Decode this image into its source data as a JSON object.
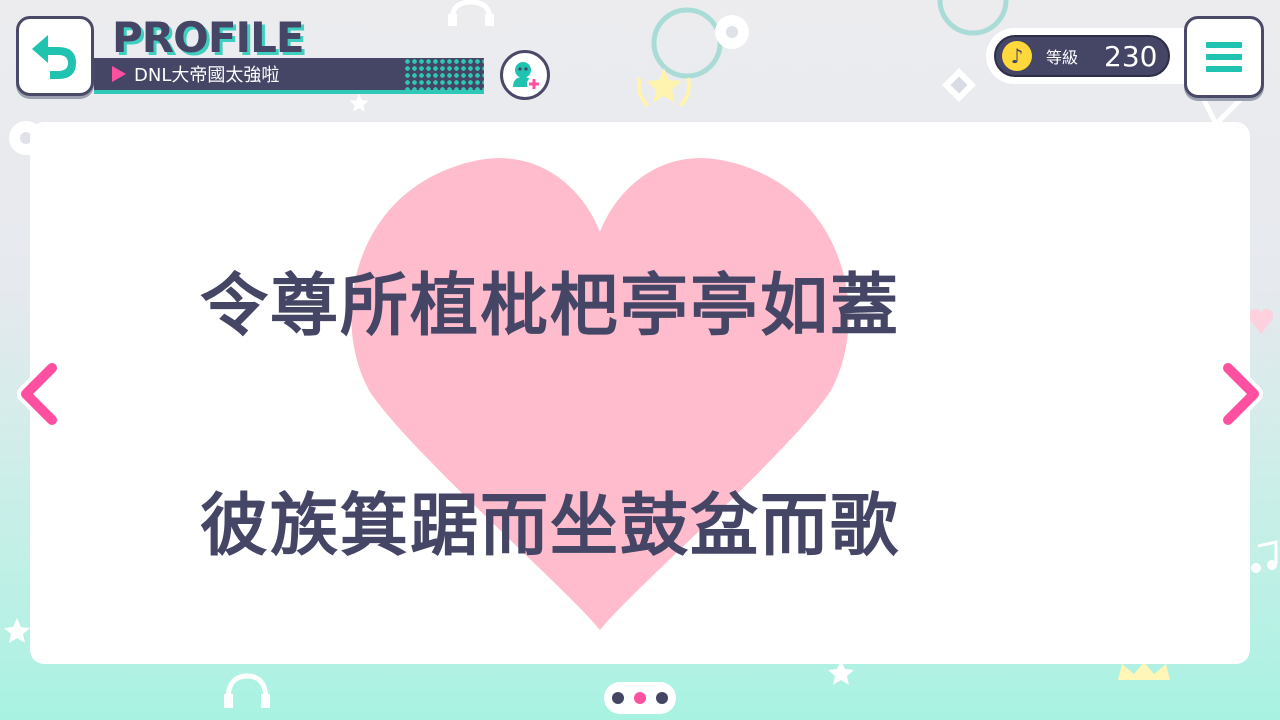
{
  "header": {
    "title": "PROFILE",
    "player_name": "DNL大帝國太強啦"
  },
  "level": {
    "label": "等級",
    "value": "230"
  },
  "card": {
    "lines": [
      "令尊所植枇杷亭亭如蓋",
      "彼族箕踞而坐鼓盆而歌"
    ]
  },
  "pager": {
    "count": 3,
    "active_index": 1
  },
  "colors": {
    "accent_pink": "#ff4fa0",
    "teal": "#1fc3b0",
    "dark": "#454566",
    "heart": "#ffbccd"
  }
}
